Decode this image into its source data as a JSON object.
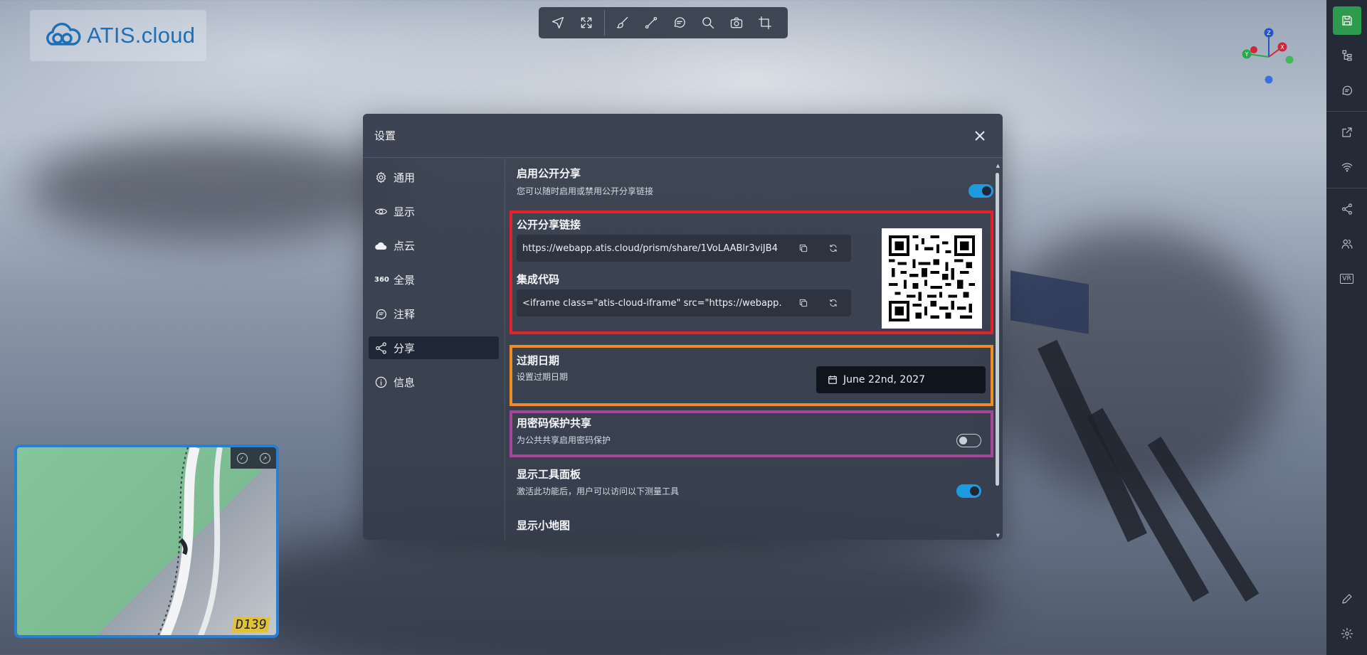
{
  "app": {
    "logo_text": "ATIS.cloud"
  },
  "toolbar": {
    "tools": [
      {
        "name": "navigate",
        "icon": "navigate-arrow-icon"
      },
      {
        "name": "fit-view",
        "icon": "expand-arrows-icon"
      },
      {
        "name": "brush",
        "icon": "brush-icon"
      },
      {
        "name": "measure",
        "icon": "measure-line-icon"
      },
      {
        "name": "annotate",
        "icon": "chat-bubble-icon"
      },
      {
        "name": "search",
        "icon": "search-icon"
      },
      {
        "name": "screenshot",
        "icon": "camera-icon"
      },
      {
        "name": "crop",
        "icon": "crop-icon"
      }
    ]
  },
  "settings": {
    "title": "设置",
    "nav": [
      {
        "key": "general",
        "label": "通用",
        "icon": "gear-icon"
      },
      {
        "key": "display",
        "label": "显示",
        "icon": "eye-icon"
      },
      {
        "key": "pointcloud",
        "label": "点云",
        "icon": "cloud-icon"
      },
      {
        "key": "panorama",
        "label": "全景",
        "icon": "panorama-360-icon",
        "glyph": "360"
      },
      {
        "key": "annotations",
        "label": "注释",
        "icon": "comment-icon"
      },
      {
        "key": "share",
        "label": "分享",
        "icon": "share-icon",
        "active": true
      },
      {
        "key": "info",
        "label": "信息",
        "icon": "info-icon"
      }
    ],
    "share": {
      "public_share": {
        "title": "启用公开分享",
        "desc": "您可以随时启用或禁用公开分享链接",
        "enabled": true
      },
      "public_link": {
        "title": "公开分享链接",
        "value": "https://webapp.atis.cloud/prism/share/1VoLAABlr3viJB4"
      },
      "embed_code": {
        "title": "集成代码",
        "value": "<iframe class=\"atis-cloud-iframe\" src=\"https://webapp."
      },
      "expiry": {
        "title": "过期日期",
        "desc": "设置过期日期",
        "date": "June 22nd, 2027"
      },
      "password": {
        "title": "用密码保护共享",
        "desc": "为公共共享启用密码保护",
        "enabled": false
      },
      "toolbox": {
        "title": "显示工具面板",
        "desc": "激活此功能后，用户可以访问以下测量工具",
        "enabled": true
      },
      "minimap": {
        "title": "显示小地图"
      }
    },
    "highlight_colors": {
      "red": "#e3222b",
      "orange": "#f08c22",
      "purple": "#a5469d"
    },
    "accent": "#1d9be0"
  },
  "minimap": {
    "label": "D139"
  },
  "gizmo": {
    "labels": [
      "Z",
      "Y",
      "X"
    ]
  }
}
